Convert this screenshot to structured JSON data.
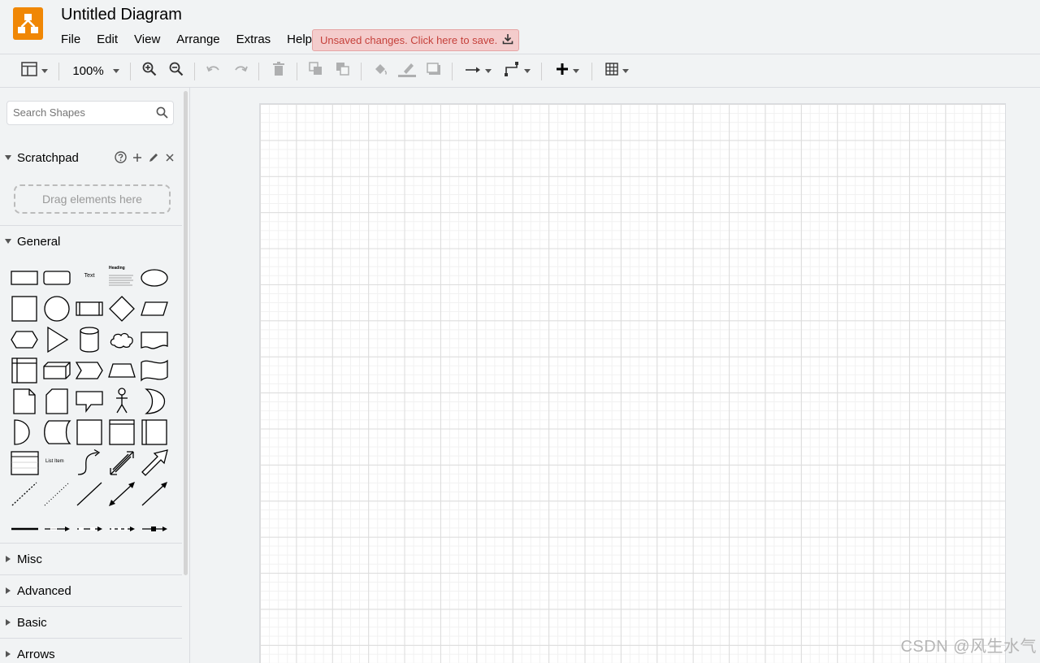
{
  "app": {
    "title": "Untitled Diagram",
    "logo_icon": "drawio-logo-icon",
    "accent_color": "#f08705"
  },
  "menu": [
    "File",
    "Edit",
    "View",
    "Arrange",
    "Extras",
    "Help"
  ],
  "unsaved_banner": {
    "label": "Unsaved changes. Click here to save.",
    "icon": "download-icon",
    "background": "#f4cccc",
    "text_color": "#c5413b"
  },
  "toolbar": {
    "zoom": "100%",
    "items": [
      "format-panel-icon",
      "zoom-in-icon",
      "zoom-out-icon",
      "undo-icon",
      "redo-icon",
      "delete-icon",
      "to-front-icon",
      "to-back-icon",
      "fill-color-icon",
      "line-color-icon",
      "shadow-icon",
      "connection-icon",
      "waypoints-icon",
      "insert-plus-icon",
      "table-icon"
    ]
  },
  "sidebar": {
    "search_placeholder": "Search Shapes",
    "scratchpad": {
      "label": "Scratchpad",
      "drop_hint": "Drag elements here",
      "icons": [
        "help-icon",
        "add-icon",
        "edit-icon",
        "close-icon"
      ]
    },
    "general": {
      "label": "General",
      "text_shape_label": "Text",
      "heading_shape_label": "Heading",
      "list_item_label": "List Item"
    },
    "collapsed_sections": [
      "Misc",
      "Advanced",
      "Basic",
      "Arrows"
    ]
  },
  "watermark": "CSDN @风生水气"
}
